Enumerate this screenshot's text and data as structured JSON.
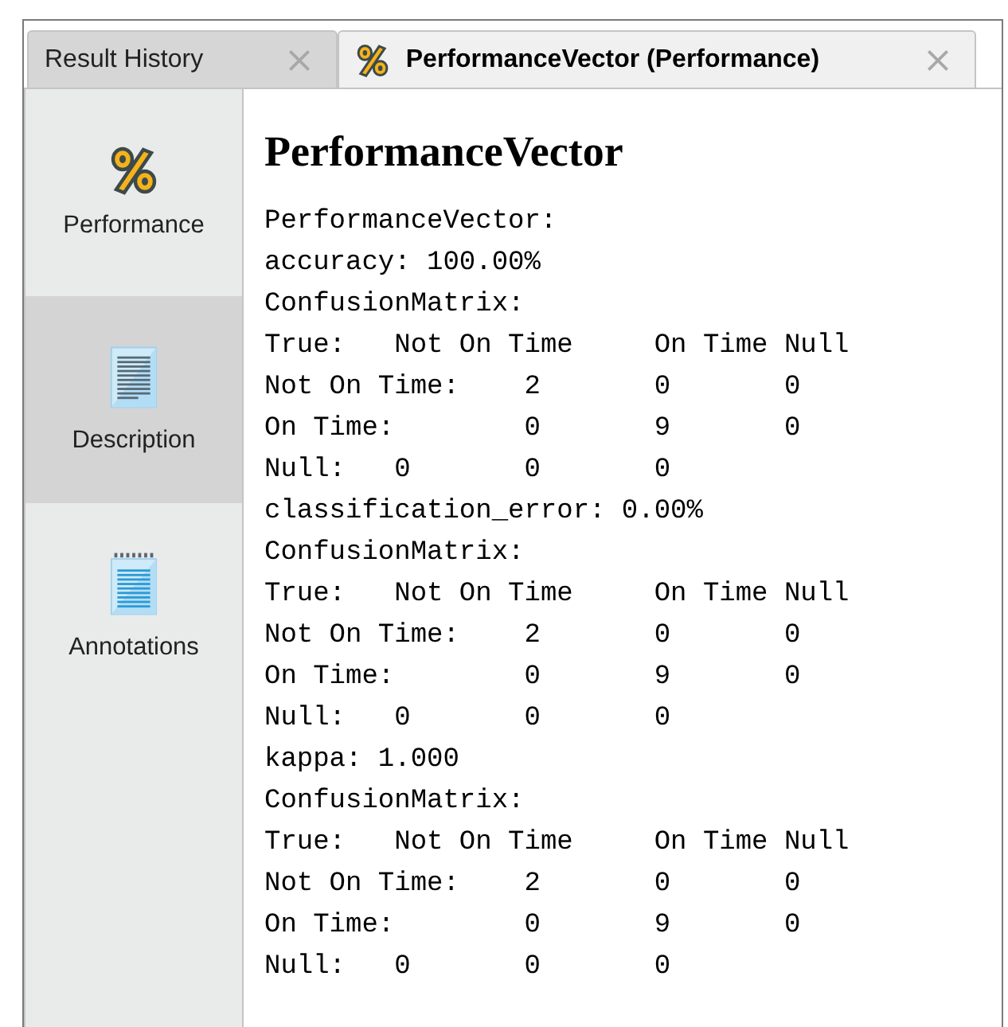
{
  "tabs": [
    {
      "label": "Result History",
      "selected": false
    },
    {
      "label": "PerformanceVector (Performance)",
      "selected": true
    }
  ],
  "sidebar": {
    "items": [
      {
        "label": "Performance",
        "selected": false
      },
      {
        "label": "Description",
        "selected": true
      },
      {
        "label": "Annotations",
        "selected": false
      }
    ]
  },
  "content": {
    "heading": "PerformanceVector",
    "lines": [
      "PerformanceVector:",
      "accuracy: 100.00%",
      "ConfusionMatrix:",
      "True:\tNot On Time\tOn Time Null",
      "Not On Time:\t2\t0\t0",
      "On Time:\t0\t9\t0",
      "Null:\t0\t0\t0",
      "classification_error: 0.00%",
      "ConfusionMatrix:",
      "True:\tNot On Time\tOn Time Null",
      "Not On Time:\t2\t0\t0",
      "On Time:\t0\t9\t0",
      "Null:\t0\t0\t0",
      "kappa: 1.000",
      "ConfusionMatrix:",
      "True:\tNot On Time\tOn Time Null",
      "Not On Time:\t2\t0\t0",
      "On Time:\t0\t9\t0",
      "Null:\t0\t0\t0"
    ]
  }
}
